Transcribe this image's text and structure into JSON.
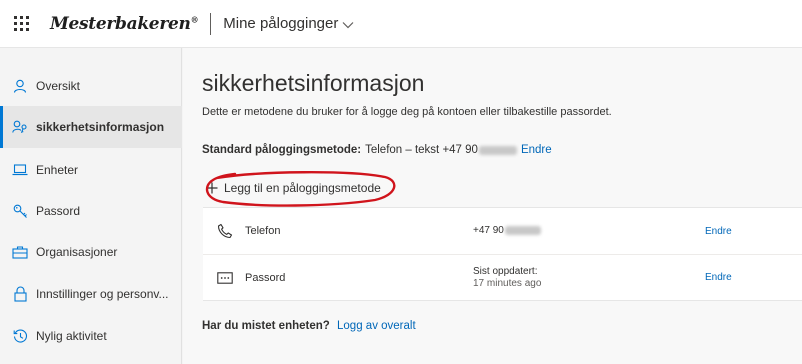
{
  "header": {
    "logo_text": "Mesterbakeren",
    "logo_mark": "®",
    "app_title": "Mine pålogginger"
  },
  "sidebar": {
    "items": [
      {
        "label": "Oversikt",
        "icon": "person-icon"
      },
      {
        "label": "sikkerhetsinformasjon",
        "icon": "person-key-icon",
        "active": true
      },
      {
        "label": "Enheter",
        "icon": "laptop-icon"
      },
      {
        "label": "Passord",
        "icon": "key-icon"
      },
      {
        "label": "Organisasjoner",
        "icon": "briefcase-icon"
      },
      {
        "label": "Innstillinger og personv...",
        "icon": "lock-icon"
      },
      {
        "label": "Nylig aktivitet",
        "icon": "history-icon"
      }
    ]
  },
  "main": {
    "title": "sikkerhetsinformasjon",
    "subtitle": "Dette er metodene du bruker for å logge deg på kontoen eller tilbakestille passordet.",
    "default_method": {
      "label": "Standard påloggingsmetode:",
      "value": "Telefon – tekst +47 90",
      "action": "Endre"
    },
    "add_method": "Legg til en påloggingsmetode",
    "methods": [
      {
        "name": "Telefon",
        "icon": "phone-icon",
        "value": "+47 90",
        "action": "Endre"
      },
      {
        "name": "Passord",
        "icon": "password-icon",
        "value": "Sist oppdatert:",
        "value_sub": "17 minutes ago",
        "action": "Endre"
      }
    ],
    "lost_device": {
      "question": "Har du mistet enheten?",
      "action": "Logg av overalt"
    }
  },
  "colors": {
    "accent": "#0078d4",
    "link": "#0067b8",
    "annotation": "#d0141c"
  }
}
